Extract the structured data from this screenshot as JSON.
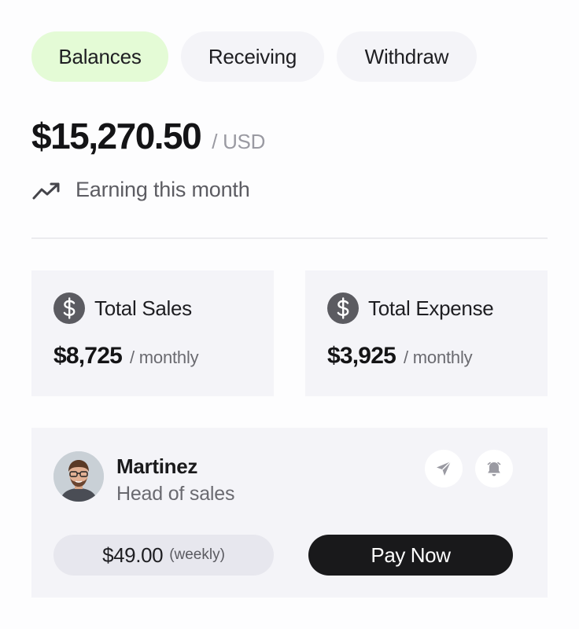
{
  "tabs": [
    {
      "label": "Balances",
      "active": true
    },
    {
      "label": "Receiving",
      "active": false
    },
    {
      "label": "Withdraw",
      "active": false
    }
  ],
  "balance": {
    "amount": "$15,270.50",
    "currency": "/ USD",
    "trend_label": "Earning this month",
    "trend_icon": "trending-up-icon"
  },
  "stats": [
    {
      "icon": "dollar-circle-icon",
      "title": "Total Sales",
      "value": "$8,725",
      "unit": "/ monthly"
    },
    {
      "icon": "dollar-circle-icon",
      "title": "Total Expense",
      "value": "$3,925",
      "unit": "/ monthly"
    }
  ],
  "profile": {
    "name": "Martinez",
    "role": "Head of sales",
    "price": "$49.00",
    "period": "(weekly)",
    "pay_label": "Pay Now",
    "actions": [
      "send-icon",
      "bell-icon"
    ]
  },
  "colors": {
    "active_tab": "#e4fbd6",
    "card_bg": "#f4f4f8",
    "pay_button": "#19191b"
  }
}
